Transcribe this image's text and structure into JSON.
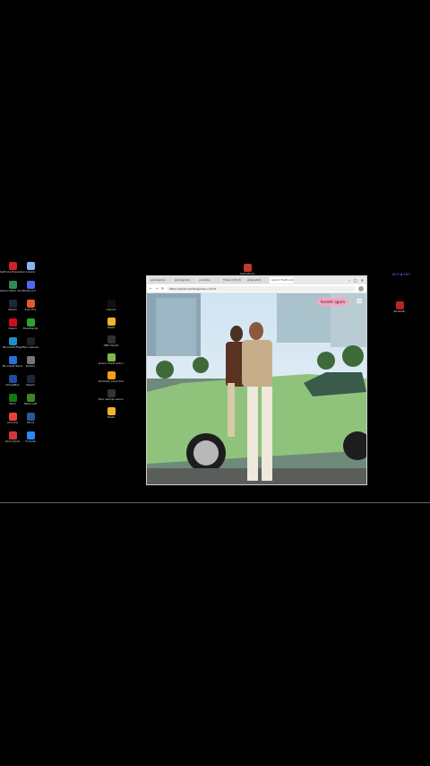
{
  "desktop": {
    "icons_left": [
      {
        "label": "GeForce Experience",
        "color": "#cc2222"
      },
      {
        "label": "Lixeira",
        "color": "#8ab4f8"
      },
      {
        "label": "Gerenciador de Mídias",
        "color": "#2e8b57"
      },
      {
        "label": "Discord",
        "color": "#5865f2"
      },
      {
        "label": "Steam",
        "color": "#1b2838"
      },
      {
        "label": "Free Fire",
        "color": "#e05a2b"
      },
      {
        "label": "Opera",
        "color": "#cc0f16"
      },
      {
        "label": "BlueStacks",
        "color": "#2aa52a"
      },
      {
        "label": "Microsoft Edge",
        "color": "#1f8fcb"
      },
      {
        "label": "Epic Games",
        "color": "#222"
      },
      {
        "label": "Microsoft Store",
        "color": "#2a6fd6"
      },
      {
        "label": "Roblox",
        "color": "#777"
      },
      {
        "label": "VirtualBox",
        "color": "#1c4da1"
      },
      {
        "label": "Steam",
        "color": "#1b2838"
      },
      {
        "label": "Xbox",
        "color": "#107c10"
      },
      {
        "label": "Minecraft",
        "color": "#3c8527"
      },
      {
        "label": "Chrome",
        "color": "#ea4335"
      },
      {
        "label": "Word",
        "color": "#2b579a"
      },
      {
        "label": "Riot Client",
        "color": "#d13639"
      },
      {
        "label": "Fortnite",
        "color": "#2d87f0"
      }
    ],
    "icons_mid": [
      {
        "label": "CapCut",
        "color": "#111"
      },
      {
        "label": "Pasta",
        "color": "#f0b429"
      },
      {
        "label": "OBS Studio",
        "color": "#302e31"
      },
      {
        "label": "Grand Theft Auto V",
        "color": "#7fb84a"
      },
      {
        "label": "Rockstar Launcher",
        "color": "#f6a01a"
      },
      {
        "label": "Epic Games Launcher",
        "color": "#333"
      },
      {
        "label": "Pasta",
        "color": "#f0b429"
      }
    ],
    "top_icon_label": "Aplicativos",
    "right_label": "Atualizar",
    "tray_text": "Wi-Fi ▪ ENG"
  },
  "browser": {
    "tabs": [
      "gamesplus",
      "gamegrabs",
      "youtube",
      "Trailer GTA VI",
      "www.gta6",
      "Grand Theft Auto"
    ],
    "window_controls": {
      "minimize": "–",
      "maximize": "□",
      "close": "✕"
    },
    "url": "https://www.rockstargames.com/VI",
    "nav": {
      "back": "←",
      "forward": "→",
      "reload": "⟳"
    },
    "content": {
      "cta_label": "Assistir agora",
      "menu_icon": "hamburger-menu-icon"
    }
  }
}
